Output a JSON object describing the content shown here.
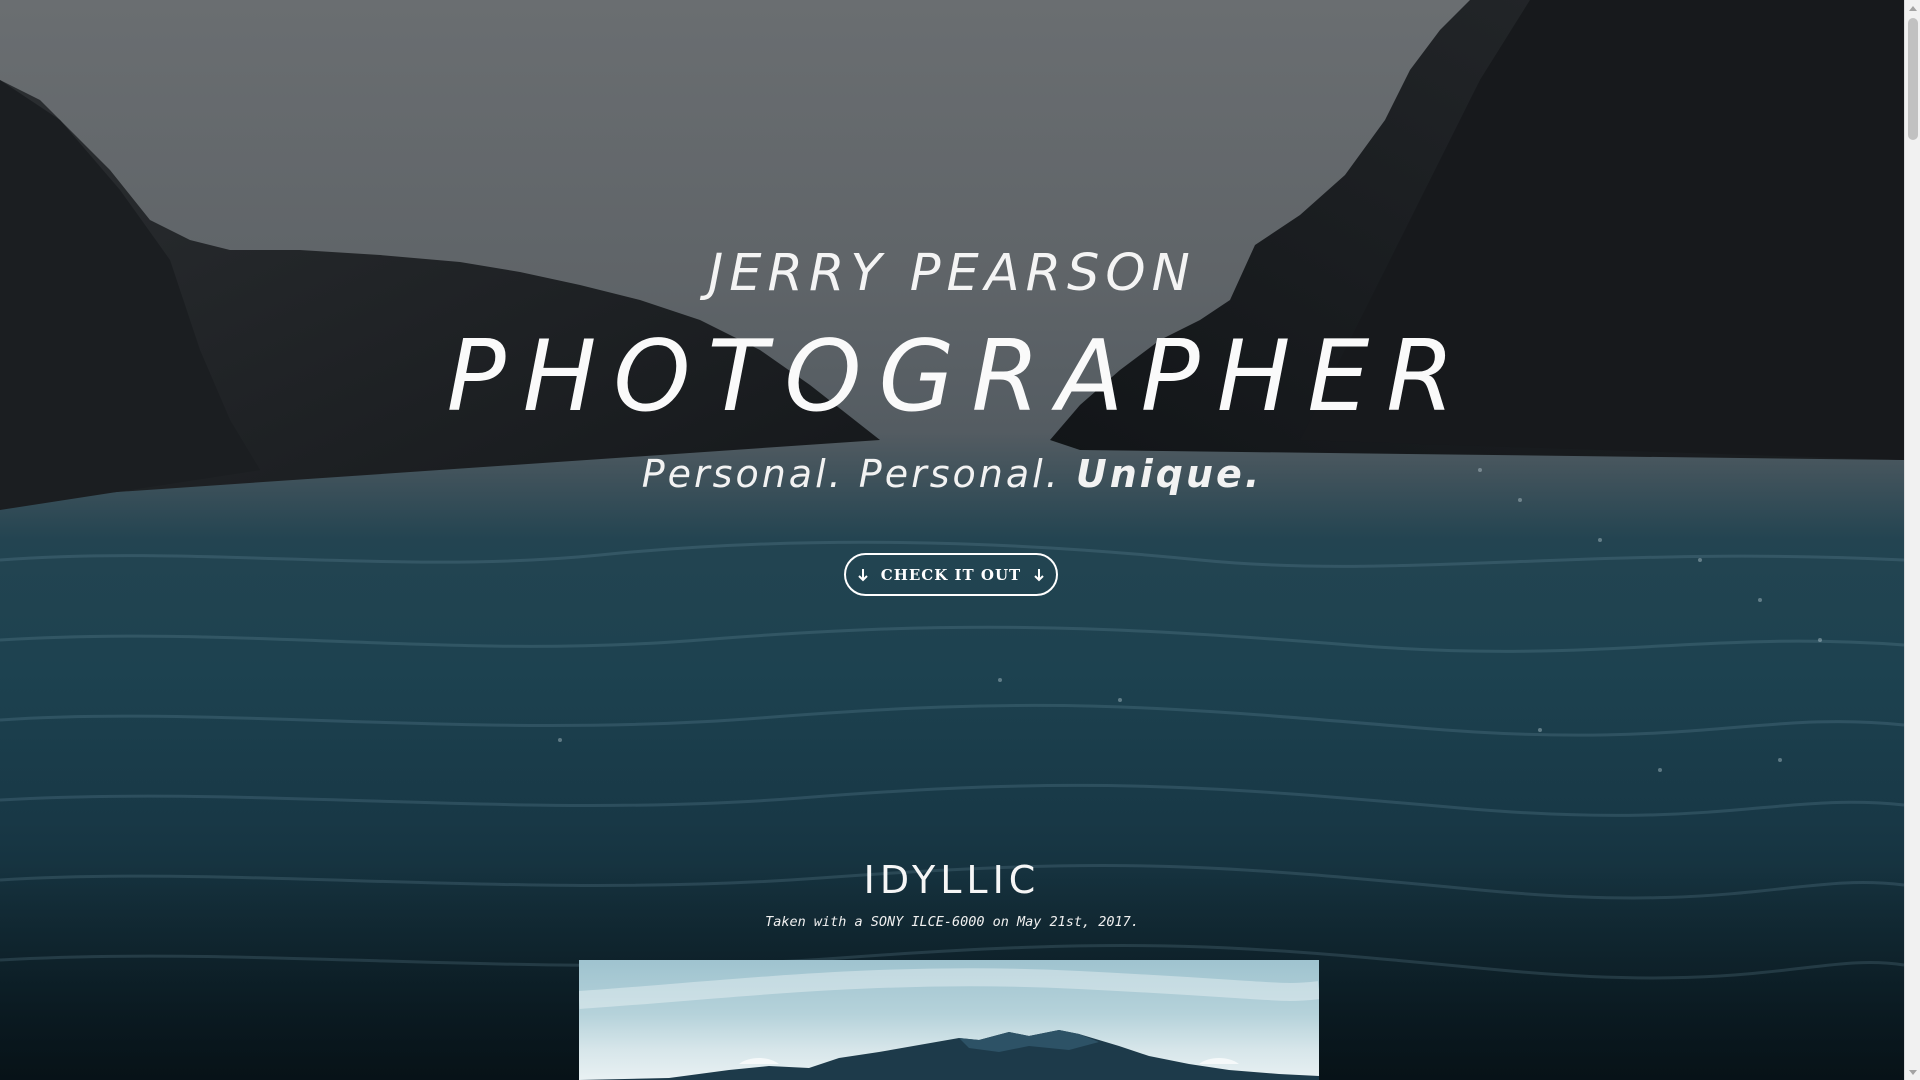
{
  "hero": {
    "name": "JERRY PEARSON",
    "title": "PHOTOGRAPHER",
    "tagline": {
      "part1": "Personal. Personal.",
      "emphasis": "Unique."
    },
    "cta": {
      "label": "CHECK IT OUT",
      "icon_left": "arrow-down-icon",
      "icon_right": "arrow-down-icon"
    }
  },
  "section": {
    "title": "IDYLLIC",
    "caption": "Taken with a SONY ILCE-6000 on May 21st, 2017."
  },
  "colors": {
    "text": "#ffffff",
    "sea": "#1d4250",
    "sky": "#6a6e71"
  }
}
